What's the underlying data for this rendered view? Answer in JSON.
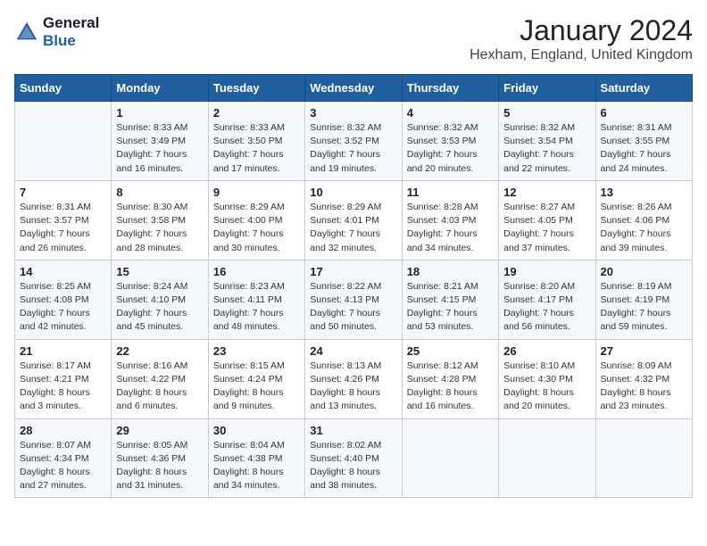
{
  "logo": {
    "line1": "General",
    "line2": "Blue"
  },
  "title": "January 2024",
  "subtitle": "Hexham, England, United Kingdom",
  "days_header": [
    "Sunday",
    "Monday",
    "Tuesday",
    "Wednesday",
    "Thursday",
    "Friday",
    "Saturday"
  ],
  "weeks": [
    [
      {
        "day": "",
        "sunrise": "",
        "sunset": "",
        "daylight": ""
      },
      {
        "day": "1",
        "sunrise": "Sunrise: 8:33 AM",
        "sunset": "Sunset: 3:49 PM",
        "daylight": "Daylight: 7 hours and 16 minutes."
      },
      {
        "day": "2",
        "sunrise": "Sunrise: 8:33 AM",
        "sunset": "Sunset: 3:50 PM",
        "daylight": "Daylight: 7 hours and 17 minutes."
      },
      {
        "day": "3",
        "sunrise": "Sunrise: 8:32 AM",
        "sunset": "Sunset: 3:52 PM",
        "daylight": "Daylight: 7 hours and 19 minutes."
      },
      {
        "day": "4",
        "sunrise": "Sunrise: 8:32 AM",
        "sunset": "Sunset: 3:53 PM",
        "daylight": "Daylight: 7 hours and 20 minutes."
      },
      {
        "day": "5",
        "sunrise": "Sunrise: 8:32 AM",
        "sunset": "Sunset: 3:54 PM",
        "daylight": "Daylight: 7 hours and 22 minutes."
      },
      {
        "day": "6",
        "sunrise": "Sunrise: 8:31 AM",
        "sunset": "Sunset: 3:55 PM",
        "daylight": "Daylight: 7 hours and 24 minutes."
      }
    ],
    [
      {
        "day": "7",
        "sunrise": "Sunrise: 8:31 AM",
        "sunset": "Sunset: 3:57 PM",
        "daylight": "Daylight: 7 hours and 26 minutes."
      },
      {
        "day": "8",
        "sunrise": "Sunrise: 8:30 AM",
        "sunset": "Sunset: 3:58 PM",
        "daylight": "Daylight: 7 hours and 28 minutes."
      },
      {
        "day": "9",
        "sunrise": "Sunrise: 8:29 AM",
        "sunset": "Sunset: 4:00 PM",
        "daylight": "Daylight: 7 hours and 30 minutes."
      },
      {
        "day": "10",
        "sunrise": "Sunrise: 8:29 AM",
        "sunset": "Sunset: 4:01 PM",
        "daylight": "Daylight: 7 hours and 32 minutes."
      },
      {
        "day": "11",
        "sunrise": "Sunrise: 8:28 AM",
        "sunset": "Sunset: 4:03 PM",
        "daylight": "Daylight: 7 hours and 34 minutes."
      },
      {
        "day": "12",
        "sunrise": "Sunrise: 8:27 AM",
        "sunset": "Sunset: 4:05 PM",
        "daylight": "Daylight: 7 hours and 37 minutes."
      },
      {
        "day": "13",
        "sunrise": "Sunrise: 8:26 AM",
        "sunset": "Sunset: 4:06 PM",
        "daylight": "Daylight: 7 hours and 39 minutes."
      }
    ],
    [
      {
        "day": "14",
        "sunrise": "Sunrise: 8:25 AM",
        "sunset": "Sunset: 4:08 PM",
        "daylight": "Daylight: 7 hours and 42 minutes."
      },
      {
        "day": "15",
        "sunrise": "Sunrise: 8:24 AM",
        "sunset": "Sunset: 4:10 PM",
        "daylight": "Daylight: 7 hours and 45 minutes."
      },
      {
        "day": "16",
        "sunrise": "Sunrise: 8:23 AM",
        "sunset": "Sunset: 4:11 PM",
        "daylight": "Daylight: 7 hours and 48 minutes."
      },
      {
        "day": "17",
        "sunrise": "Sunrise: 8:22 AM",
        "sunset": "Sunset: 4:13 PM",
        "daylight": "Daylight: 7 hours and 50 minutes."
      },
      {
        "day": "18",
        "sunrise": "Sunrise: 8:21 AM",
        "sunset": "Sunset: 4:15 PM",
        "daylight": "Daylight: 7 hours and 53 minutes."
      },
      {
        "day": "19",
        "sunrise": "Sunrise: 8:20 AM",
        "sunset": "Sunset: 4:17 PM",
        "daylight": "Daylight: 7 hours and 56 minutes."
      },
      {
        "day": "20",
        "sunrise": "Sunrise: 8:19 AM",
        "sunset": "Sunset: 4:19 PM",
        "daylight": "Daylight: 7 hours and 59 minutes."
      }
    ],
    [
      {
        "day": "21",
        "sunrise": "Sunrise: 8:17 AM",
        "sunset": "Sunset: 4:21 PM",
        "daylight": "Daylight: 8 hours and 3 minutes."
      },
      {
        "day": "22",
        "sunrise": "Sunrise: 8:16 AM",
        "sunset": "Sunset: 4:22 PM",
        "daylight": "Daylight: 8 hours and 6 minutes."
      },
      {
        "day": "23",
        "sunrise": "Sunrise: 8:15 AM",
        "sunset": "Sunset: 4:24 PM",
        "daylight": "Daylight: 8 hours and 9 minutes."
      },
      {
        "day": "24",
        "sunrise": "Sunrise: 8:13 AM",
        "sunset": "Sunset: 4:26 PM",
        "daylight": "Daylight: 8 hours and 13 minutes."
      },
      {
        "day": "25",
        "sunrise": "Sunrise: 8:12 AM",
        "sunset": "Sunset: 4:28 PM",
        "daylight": "Daylight: 8 hours and 16 minutes."
      },
      {
        "day": "26",
        "sunrise": "Sunrise: 8:10 AM",
        "sunset": "Sunset: 4:30 PM",
        "daylight": "Daylight: 8 hours and 20 minutes."
      },
      {
        "day": "27",
        "sunrise": "Sunrise: 8:09 AM",
        "sunset": "Sunset: 4:32 PM",
        "daylight": "Daylight: 8 hours and 23 minutes."
      }
    ],
    [
      {
        "day": "28",
        "sunrise": "Sunrise: 8:07 AM",
        "sunset": "Sunset: 4:34 PM",
        "daylight": "Daylight: 8 hours and 27 minutes."
      },
      {
        "day": "29",
        "sunrise": "Sunrise: 8:05 AM",
        "sunset": "Sunset: 4:36 PM",
        "daylight": "Daylight: 8 hours and 31 minutes."
      },
      {
        "day": "30",
        "sunrise": "Sunrise: 8:04 AM",
        "sunset": "Sunset: 4:38 PM",
        "daylight": "Daylight: 8 hours and 34 minutes."
      },
      {
        "day": "31",
        "sunrise": "Sunrise: 8:02 AM",
        "sunset": "Sunset: 4:40 PM",
        "daylight": "Daylight: 8 hours and 38 minutes."
      },
      {
        "day": "",
        "sunrise": "",
        "sunset": "",
        "daylight": ""
      },
      {
        "day": "",
        "sunrise": "",
        "sunset": "",
        "daylight": ""
      },
      {
        "day": "",
        "sunrise": "",
        "sunset": "",
        "daylight": ""
      }
    ]
  ]
}
